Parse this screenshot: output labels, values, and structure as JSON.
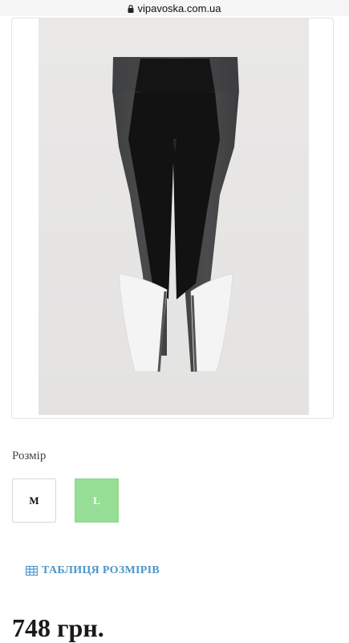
{
  "browser": {
    "url": "vipavoska.com.ua"
  },
  "product": {
    "image_icon": "product-photo-leggings",
    "size_label": "Розмір",
    "sizes": [
      {
        "label": "M",
        "selected": false
      },
      {
        "label": "L",
        "selected": true
      }
    ],
    "size_table_label": "ТАБЛИЦЯ РОЗМІРІВ",
    "size_table_icon": "table-icon",
    "price": "748 грн."
  },
  "colors": {
    "selected_size": "#96de96",
    "link": "#4d95c8"
  }
}
